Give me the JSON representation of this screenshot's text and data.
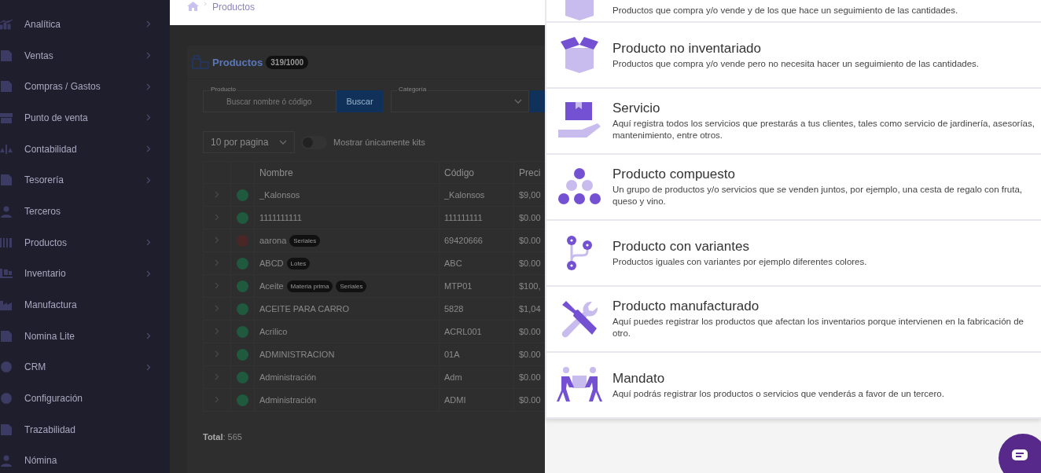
{
  "sidebar": {
    "items": [
      {
        "label": "Analítica",
        "expandable": true
      },
      {
        "label": "Ventas",
        "expandable": true
      },
      {
        "label": "Compras / Gastos",
        "expandable": true
      },
      {
        "label": "Punto de venta",
        "expandable": true
      },
      {
        "label": "Contabilidad",
        "expandable": true
      },
      {
        "label": "Tesorería",
        "expandable": true
      },
      {
        "label": "Terceros",
        "expandable": false
      },
      {
        "label": "Productos",
        "expandable": true
      },
      {
        "label": "Inventario",
        "expandable": true
      },
      {
        "label": "Manufactura",
        "expandable": false
      },
      {
        "label": "Nomina Lite",
        "expandable": true
      },
      {
        "label": "CRM",
        "expandable": true
      },
      {
        "label": "Configuración",
        "expandable": false
      },
      {
        "label": "Trazabilidad",
        "expandable": false
      },
      {
        "label": "Nómina",
        "expandable": false
      }
    ]
  },
  "breadcrumb": {
    "items": [
      "Productos"
    ]
  },
  "products_panel": {
    "title": "Productos",
    "badge": "319/1000",
    "product_filter": {
      "label": "Producto",
      "placeholder": "Buscar nombre ó código",
      "button": "Buscar"
    },
    "category_filter": {
      "label": "Categoría"
    },
    "page_size": "10 por pagina",
    "kits_toggle": {
      "label": "Mostrar únicamente kits",
      "on": false
    },
    "table": {
      "columns": [
        "Nombre",
        "Código",
        "Preci"
      ],
      "rows": [
        {
          "name": "_Kalonsos",
          "tags": [],
          "code": "_Kalonsos",
          "price": "$9,00",
          "color": "#1f5a3e"
        },
        {
          "name": "1111111111",
          "tags": [],
          "code": "111111111",
          "price": "$0.00",
          "color": "#1f5a3e"
        },
        {
          "name": "aarona",
          "tags": [
            "Seriales"
          ],
          "code": "69420666",
          "price": "$0.00",
          "color": "#4a2626"
        },
        {
          "name": "ABCD",
          "tags": [
            "Lotes"
          ],
          "code": "ABC",
          "price": "$0.00",
          "color": "#1f5a3e"
        },
        {
          "name": "Aceite",
          "tags": [
            "Materia prima",
            "Seriales"
          ],
          "code": "MTP01",
          "price": "$100,",
          "color": "#1f5a3e"
        },
        {
          "name": "ACEITE PARA CARRO",
          "tags": [],
          "code": "5828",
          "price": "$1,04",
          "color": "#1f5a3e"
        },
        {
          "name": "Acrilico",
          "tags": [],
          "code": "ACRL001",
          "price": "$0.00",
          "color": "#1f5a3e"
        },
        {
          "name": "ADMINISTRACION",
          "tags": [],
          "code": "01A",
          "price": "$0.00",
          "color": "#1f5a3e"
        },
        {
          "name": "Administración",
          "tags": [],
          "code": "Adm",
          "price": "$0.00",
          "color": "#1f5a3e"
        },
        {
          "name": "Administración",
          "tags": [],
          "code": "ADMI",
          "price": "$0.00",
          "color": "#1f5a3e"
        }
      ]
    },
    "total": "**Total**: 565"
  },
  "type_options": [
    {
      "kind": "inventoried",
      "description": "Productos que compra y/o vende y de los que hace un seguimiento de las cantidades."
    },
    {
      "kind": "box",
      "title": "Producto no inventariado",
      "description": "Productos que compra y/o vende pero no necesita hacer un seguimiento de las cantidades."
    },
    {
      "kind": "service",
      "title": "Servicio",
      "description": "Aquí registra todos los servicios que prestarás a tus clientes, tales como servicio de jardinería, asesorías, mantenimiento, entre otros."
    },
    {
      "kind": "composite",
      "title": "Producto compuesto",
      "description": "Un grupo de productos y/o servicios que se venden juntos, por ejemplo, una cesta de regalo con fruta, queso y vino."
    },
    {
      "kind": "variants",
      "title": "Producto con variantes",
      "description": "Productos iguales con variantes por ejemplo diferentes colores."
    },
    {
      "kind": "manufactured",
      "title": "Producto manufacturado",
      "description": "Aquí puedes registrar los productos que afectan los inventarios porque intervienen en la fabricación de otro."
    },
    {
      "kind": "mandate",
      "title": "Mandato",
      "description": "Aquí podrás registrar los productos o servicios que venderás a favor de un tercero."
    }
  ]
}
